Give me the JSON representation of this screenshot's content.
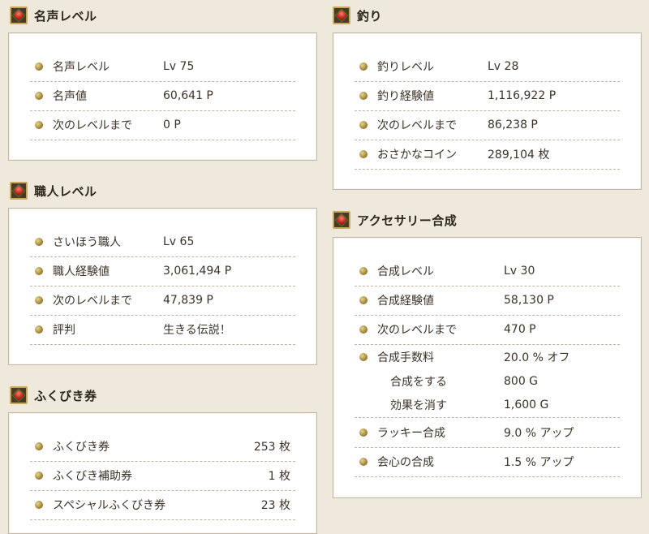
{
  "fame": {
    "title": "名声レベル",
    "rows": [
      {
        "label": "名声レベル",
        "value": "Lv 75"
      },
      {
        "label": "名声値",
        "value": "60,641 P"
      },
      {
        "label": "次のレベルまで",
        "value": "0 P"
      }
    ]
  },
  "craft": {
    "title": "職人レベル",
    "rows": [
      {
        "label": "さいほう職人",
        "value": "Lv 65"
      },
      {
        "label": "職人経験値",
        "value": "3,061,494 P"
      },
      {
        "label": "次のレベルまで",
        "value": "47,839 P"
      },
      {
        "label": "評判",
        "value": "生きる伝説！"
      }
    ]
  },
  "lottery": {
    "title": "ふくびき券",
    "rows": [
      {
        "label": "ふくびき券",
        "value": "253 枚"
      },
      {
        "label": "ふくびき補助券",
        "value": "1 枚"
      },
      {
        "label": "スペシャルふくびき券",
        "value": "23 枚"
      }
    ]
  },
  "fishing": {
    "title": "釣り",
    "rows": [
      {
        "label": "釣りレベル",
        "value": "Lv 28"
      },
      {
        "label": "釣り経験値",
        "value": "1,116,922 P"
      },
      {
        "label": "次のレベルまで",
        "value": "86,238 P"
      },
      {
        "label": "おさかなコイン",
        "value": "289,104 枚"
      }
    ]
  },
  "accessory": {
    "title": "アクセサリー合成",
    "rows": [
      {
        "label": "合成レベル",
        "value": "Lv 30"
      },
      {
        "label": "合成経験値",
        "value": "58,130 P"
      },
      {
        "label": "次のレベルまで",
        "value": "470 P"
      },
      {
        "label": "合成手数料",
        "value": "20.0 % オフ"
      },
      {
        "label": "合成をする",
        "value": "800 G"
      },
      {
        "label": "効果を消す",
        "value": "1,600 G"
      },
      {
        "label": "ラッキー合成",
        "value": "9.0 % アップ"
      },
      {
        "label": "会心の合成",
        "value": "1.5 % アップ"
      }
    ]
  }
}
